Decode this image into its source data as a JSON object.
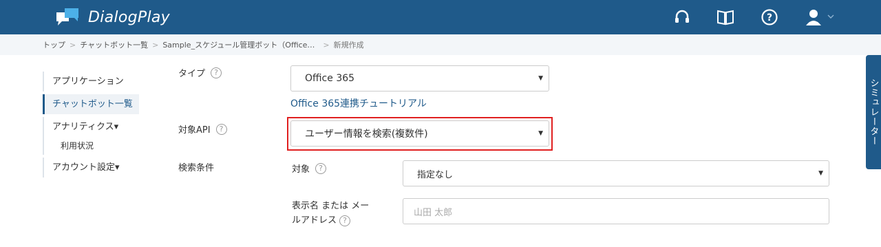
{
  "app": {
    "name": "DialogPlay"
  },
  "breadcrumb": {
    "items": [
      "トップ",
      "チャットボット一覧",
      "Sample_スケジュール管理ボット（Office…"
    ],
    "current": "新規作成"
  },
  "sidebar": {
    "items": [
      {
        "label": "アプリケーション"
      },
      {
        "label": "チャットボット一覧"
      },
      {
        "label": "アナリティクス▾"
      },
      {
        "label": "利用状況"
      },
      {
        "label": "アカウント設定▾"
      }
    ]
  },
  "form": {
    "type_label": "タイプ",
    "type_value": "Office 365",
    "tutorial_link": "Office 365連携チュートリアル",
    "api_label": "対象API",
    "api_value": "ユーザー情報を検索(複数件)",
    "search_label": "検索条件",
    "target_label": "対象",
    "target_value": "指定なし",
    "name_label_line1": "表示名 または メー",
    "name_label_line2": "ルアドレス",
    "name_placeholder": "山田 太郎"
  },
  "simulator": {
    "label": "シミュレーター"
  },
  "colors": {
    "header": "#1f5a8a",
    "highlight": "#e02020"
  }
}
